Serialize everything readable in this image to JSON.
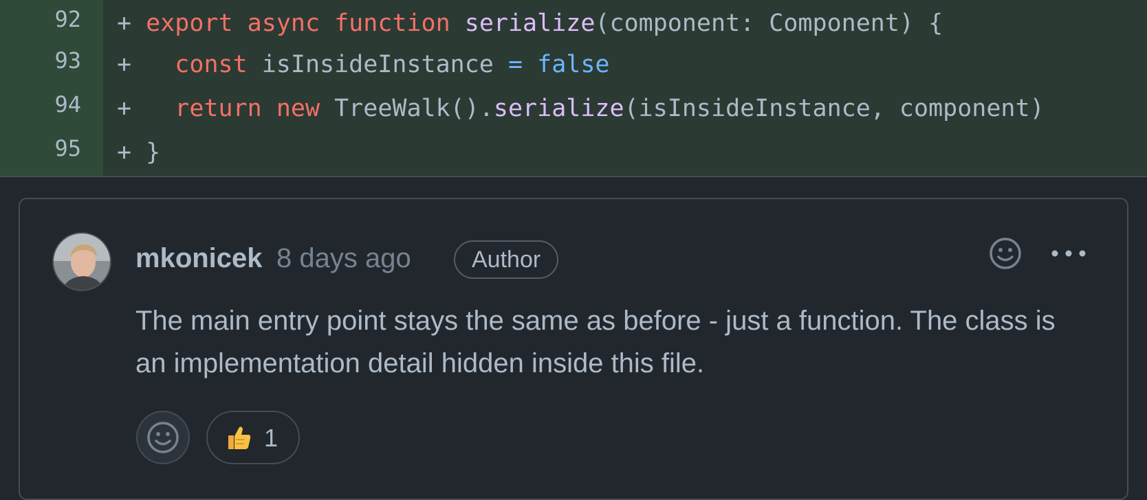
{
  "diff": {
    "lines": [
      {
        "number": "92",
        "marker": "+"
      },
      {
        "number": "93",
        "marker": "+"
      },
      {
        "number": "94",
        "marker": "+"
      },
      {
        "number": "95",
        "marker": "+"
      }
    ],
    "tokens": {
      "l92": [
        "export",
        "async",
        "function",
        "serialize",
        "(component: Component) {"
      ],
      "l93": [
        "const",
        "isInsideInstance",
        "=",
        "false"
      ],
      "l94": [
        "return",
        "new",
        "TreeWalk().",
        "serialize",
        "(isInsideInstance, component)"
      ],
      "l95": [
        "}"
      ]
    },
    "colors": {
      "keyword": "#f47067",
      "function": "#dcbdfb",
      "constant": "#6cb6ff",
      "text": "#adbac7",
      "added_bg": "#2b3a33",
      "gutter_bg": "#2f4a39"
    }
  },
  "comment": {
    "author": "mkonicek",
    "time": "8 days ago",
    "badge": "Author",
    "body": "The main entry point stays the same as before - just a function. The class is an implementation detail hidden inside this file.",
    "reactions": [
      {
        "emoji": "👍",
        "count": "1"
      }
    ],
    "icons": [
      "smiley-icon",
      "kebab-menu-icon"
    ]
  }
}
